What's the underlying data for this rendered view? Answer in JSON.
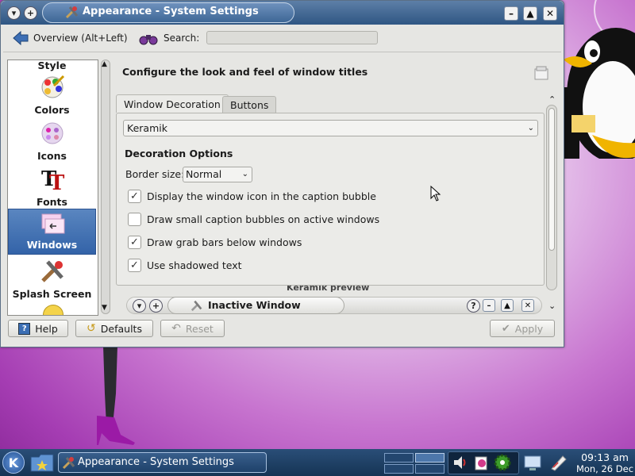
{
  "window": {
    "title": "Appearance - System Settings",
    "help_label": "?"
  },
  "toolbar": {
    "overview_label": "Overview (Alt+Left)",
    "search_label": "Search:",
    "search_value": ""
  },
  "sidebar": {
    "items": [
      {
        "label": "Style"
      },
      {
        "label": "Colors"
      },
      {
        "label": "Icons"
      },
      {
        "label": "Fonts"
      },
      {
        "label": "Windows",
        "selected": true
      },
      {
        "label": "Splash Screen"
      }
    ]
  },
  "content": {
    "heading": "Configure the look and feel of window titles",
    "tabs": [
      {
        "label": "Window Decoration",
        "active": true
      },
      {
        "label": "Buttons",
        "active": false
      }
    ],
    "decoration_value": "Keramik",
    "options_heading": "Decoration Options",
    "border_size_label": "Border size:",
    "border_size_value": "Normal",
    "checkboxes": [
      {
        "label": "Display the window icon in the caption bubble",
        "checked": true
      },
      {
        "label": "Draw small caption bubbles on active windows",
        "checked": false
      },
      {
        "label": "Draw grab bars below windows",
        "checked": true
      },
      {
        "label": "Use shadowed text",
        "checked": true
      }
    ],
    "preview_partial_text": "Keramik preview",
    "preview_title": "Inactive Window"
  },
  "buttons": {
    "help": "Help",
    "defaults": "Defaults",
    "reset": "Reset",
    "apply": "Apply"
  },
  "taskbar": {
    "task_label": "Appearance - System Settings",
    "time": "09:13 am",
    "date": "Mon, 26 Dec"
  },
  "colors": {
    "titlebar": "#2f5683",
    "selection": "#3363a8",
    "desktop": "#c774cf"
  }
}
